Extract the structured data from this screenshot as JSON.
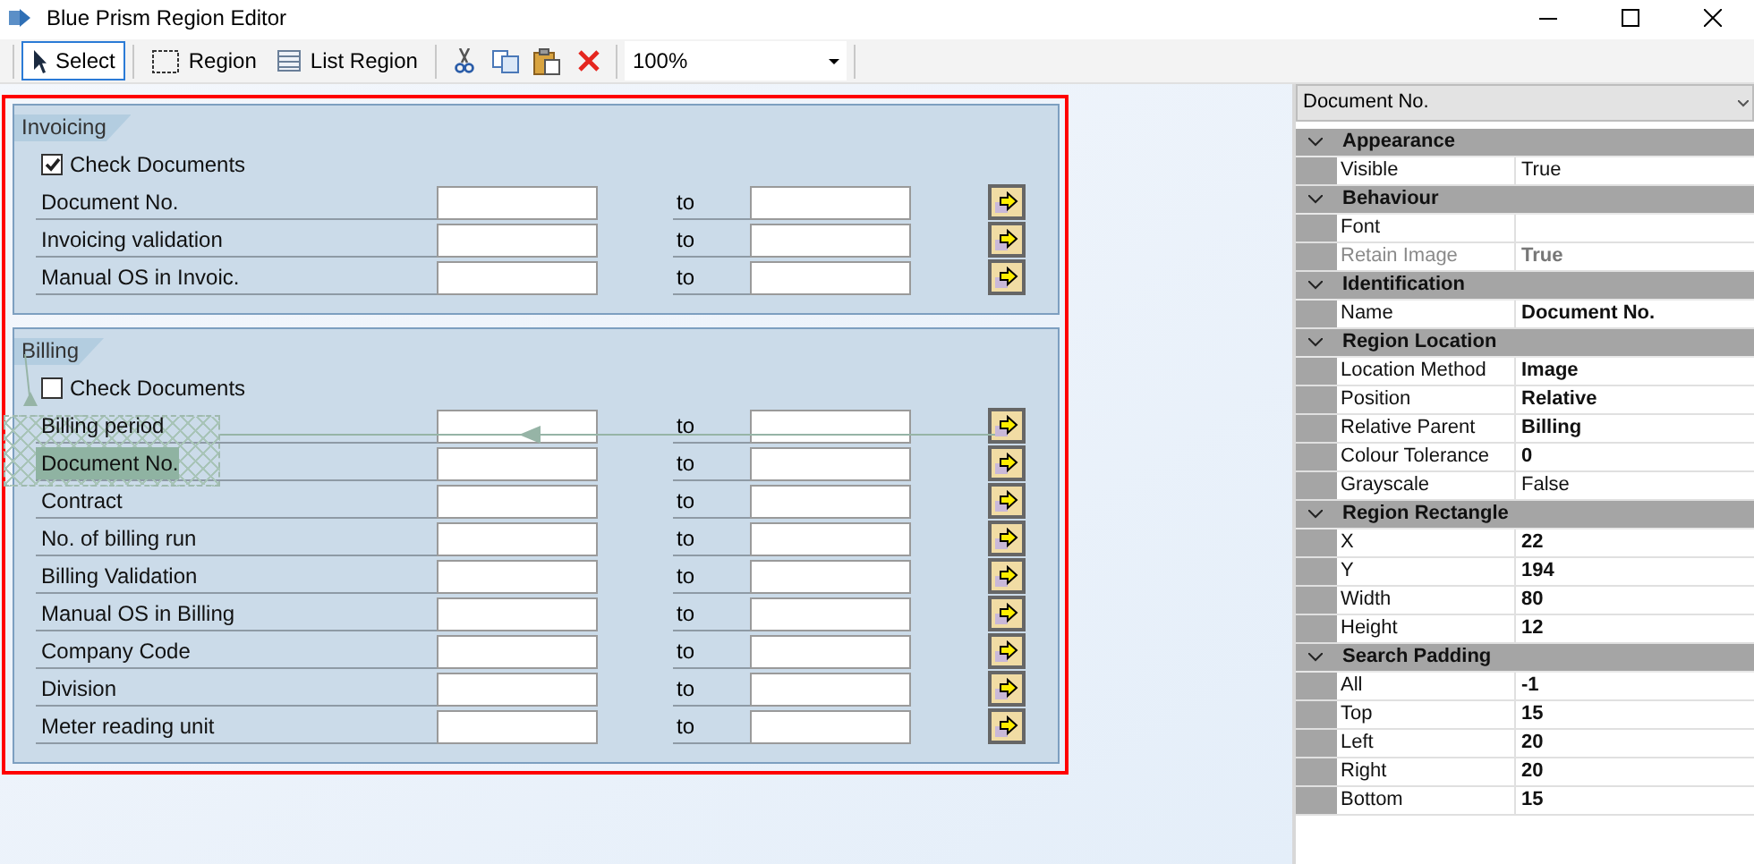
{
  "window": {
    "title": "Blue Prism Region Editor"
  },
  "toolbar": {
    "tools": [
      {
        "kind": "select",
        "label": "Select",
        "selected": true
      },
      {
        "kind": "region",
        "label": "Region",
        "selected": false
      },
      {
        "kind": "list",
        "label": "List Region",
        "selected": false
      }
    ],
    "actions": [
      {
        "kind": "cut"
      },
      {
        "kind": "copy"
      },
      {
        "kind": "paste"
      },
      {
        "kind": "delete"
      }
    ],
    "zoom": "100%"
  },
  "groups": [
    {
      "title": "Invoicing",
      "check_label": "Check Documents",
      "checked": true,
      "rows": [
        {
          "label": "Document No.",
          "to": "to",
          "selected": false
        },
        {
          "label": "Invoicing validation",
          "to": "to",
          "selected": false
        },
        {
          "label": "Manual OS in Invoic.",
          "to": "to",
          "selected": false
        }
      ]
    },
    {
      "title": "Billing",
      "check_label": "Check Documents",
      "checked": false,
      "rows": [
        {
          "label": "Billing period",
          "to": "to",
          "selected": false
        },
        {
          "label": "Document No.",
          "to": "to",
          "selected": true
        },
        {
          "label": "Contract",
          "to": "to",
          "selected": false
        },
        {
          "label": "No. of billing run",
          "to": "to",
          "selected": false
        },
        {
          "label": "Billing Validation",
          "to": "to",
          "selected": false
        },
        {
          "label": "Manual OS in Billing",
          "to": "to",
          "selected": false
        },
        {
          "label": "Company Code",
          "to": "to",
          "selected": false
        },
        {
          "label": "Division",
          "to": "to",
          "selected": false
        },
        {
          "label": "Meter reading unit",
          "to": "to",
          "selected": false
        }
      ]
    }
  ],
  "properties": {
    "selected_object": "Document No.",
    "categories": [
      {
        "name": "Appearance",
        "expanded": true,
        "items": [
          {
            "name": "Visible",
            "value": "True",
            "modified": false,
            "disabled": false
          }
        ]
      },
      {
        "name": "Behaviour",
        "expanded": true,
        "items": [
          {
            "name": "Font",
            "disabled": false
          },
          {
            "name": "Retain Image",
            "value": "True",
            "modified": true,
            "disabled": true
          }
        ]
      },
      {
        "name": "Identification",
        "expanded": true,
        "items": [
          {
            "name": "Name",
            "value": "Document No.",
            "modified": true,
            "disabled": false
          }
        ]
      },
      {
        "name": "Region Location",
        "expanded": true,
        "items": [
          {
            "name": "Location Method",
            "value": "Image",
            "modified": true,
            "disabled": false
          },
          {
            "name": "Position",
            "value": "Relative",
            "modified": true,
            "disabled": false
          },
          {
            "name": "Relative Parent",
            "value": "Billing",
            "modified": true,
            "disabled": false
          },
          {
            "name": "Colour Tolerance",
            "value": "0",
            "modified": true,
            "disabled": false
          },
          {
            "name": "Grayscale",
            "value": "False",
            "modified": false,
            "disabled": false
          }
        ]
      },
      {
        "name": "Region Rectangle",
        "expanded": true,
        "items": [
          {
            "name": "X",
            "value": "22",
            "modified": true,
            "disabled": false
          },
          {
            "name": "Y",
            "value": "194",
            "modified": true,
            "disabled": false
          },
          {
            "name": "Width",
            "value": "80",
            "modified": true,
            "disabled": false
          },
          {
            "name": "Height",
            "value": "12",
            "modified": true,
            "disabled": false
          }
        ]
      },
      {
        "name": "Search Padding",
        "expanded": true,
        "items": [
          {
            "name": "All",
            "value": "-1",
            "modified": true,
            "disabled": false
          },
          {
            "name": "Top",
            "value": "15",
            "modified": true,
            "disabled": false
          },
          {
            "name": "Left",
            "value": "20",
            "modified": true,
            "disabled": false
          },
          {
            "name": "Right",
            "value": "20",
            "modified": true,
            "disabled": false
          },
          {
            "name": "Bottom",
            "value": "15",
            "modified": true,
            "disabled": false
          }
        ]
      }
    ]
  }
}
